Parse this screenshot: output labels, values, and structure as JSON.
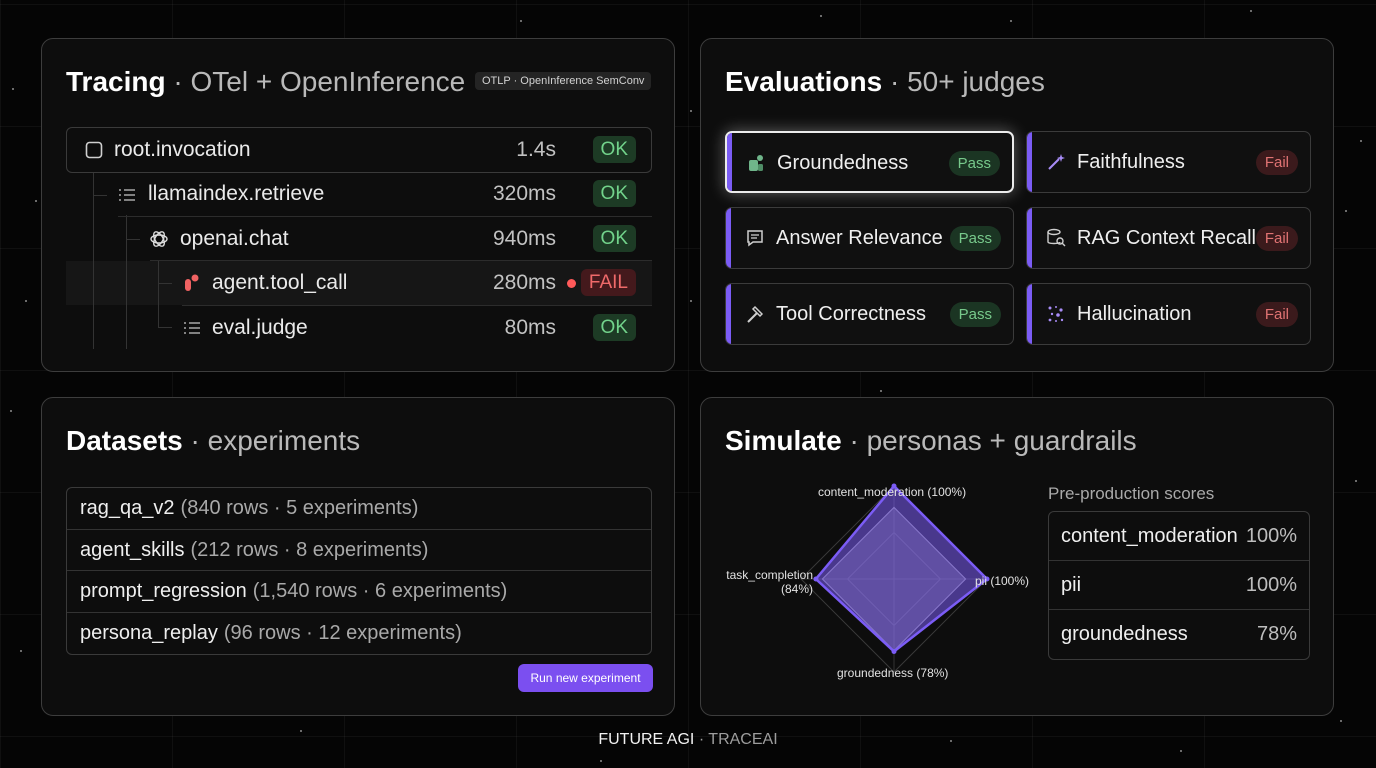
{
  "tracing": {
    "title": "Tracing",
    "separator": "·",
    "subtitle": "OTel + OpenInference",
    "badge": "OTLP · OpenInference SemConv",
    "spans": [
      {
        "name": "root.invocation",
        "duration": "1.4s",
        "status": "OK",
        "icon": "checkbox-icon"
      },
      {
        "name": "llamaindex.retrieve",
        "duration": "320ms",
        "status": "OK",
        "icon": "list-icon"
      },
      {
        "name": "openai.chat",
        "duration": "940ms",
        "status": "OK",
        "icon": "openai-icon"
      },
      {
        "name": "agent.tool_call",
        "duration": "280ms",
        "status": "FAIL",
        "icon": "tool-call-icon"
      },
      {
        "name": "eval.judge",
        "duration": "80ms",
        "status": "OK",
        "icon": "list-icon"
      }
    ]
  },
  "evaluations": {
    "title": "Evaluations",
    "separator": "·",
    "subtitle": "50+ judges",
    "judges": [
      {
        "name": "Groundedness",
        "result": "Pass",
        "icon": "groundedness-icon"
      },
      {
        "name": "Faithfulness",
        "result": "Fail",
        "icon": "magic-wand-icon"
      },
      {
        "name": "Answer Relevance",
        "result": "Pass",
        "icon": "message-icon"
      },
      {
        "name": "RAG Context Recall",
        "result": "Fail",
        "icon": "database-search-icon"
      },
      {
        "name": "Tool Correctness",
        "result": "Pass",
        "icon": "hammer-icon"
      },
      {
        "name": "Hallucination",
        "result": "Fail",
        "icon": "sparkle-icon"
      }
    ],
    "accent_color": "#7b5cf5"
  },
  "datasets": {
    "title": "Datasets",
    "separator": "·",
    "subtitle": "experiments",
    "rows": [
      {
        "name": "rag_qa_v2",
        "meta": "(840 rows · 5 experiments)"
      },
      {
        "name": "agent_skills",
        "meta": "(212 rows · 8 experiments)"
      },
      {
        "name": "prompt_regression",
        "meta": "(1,540 rows · 6 experiments)"
      },
      {
        "name": "persona_replay",
        "meta": "(96 rows · 12 experiments)"
      }
    ],
    "run_button": "Run new experiment",
    "button_color": "#7b4ff0"
  },
  "simulate": {
    "title": "Simulate",
    "separator": "·",
    "subtitle": "personas + guardrails",
    "scores_heading": "Pre-production scores",
    "radar_labels": {
      "top": "content_moderation (100%)",
      "right": "pii (100%)",
      "bottom": "groundedness (78%)",
      "left_line1": "task_completion",
      "left_line2": "(84%)"
    },
    "scores": [
      {
        "name": "content_moderation",
        "value": "100%"
      },
      {
        "name": "pii",
        "value": "100%"
      },
      {
        "name": "groundedness",
        "value": "78%"
      }
    ]
  },
  "chart_data": {
    "type": "radar",
    "axes": [
      "content_moderation",
      "pii",
      "groundedness",
      "task_completion"
    ],
    "series": [
      {
        "values": [
          100,
          100,
          78,
          84
        ],
        "color": "#7b5cf5"
      }
    ],
    "range": [
      0,
      100
    ]
  },
  "footer": {
    "brand": "FUTURE AGI",
    "separator": "·",
    "product": "TRACEAI"
  }
}
